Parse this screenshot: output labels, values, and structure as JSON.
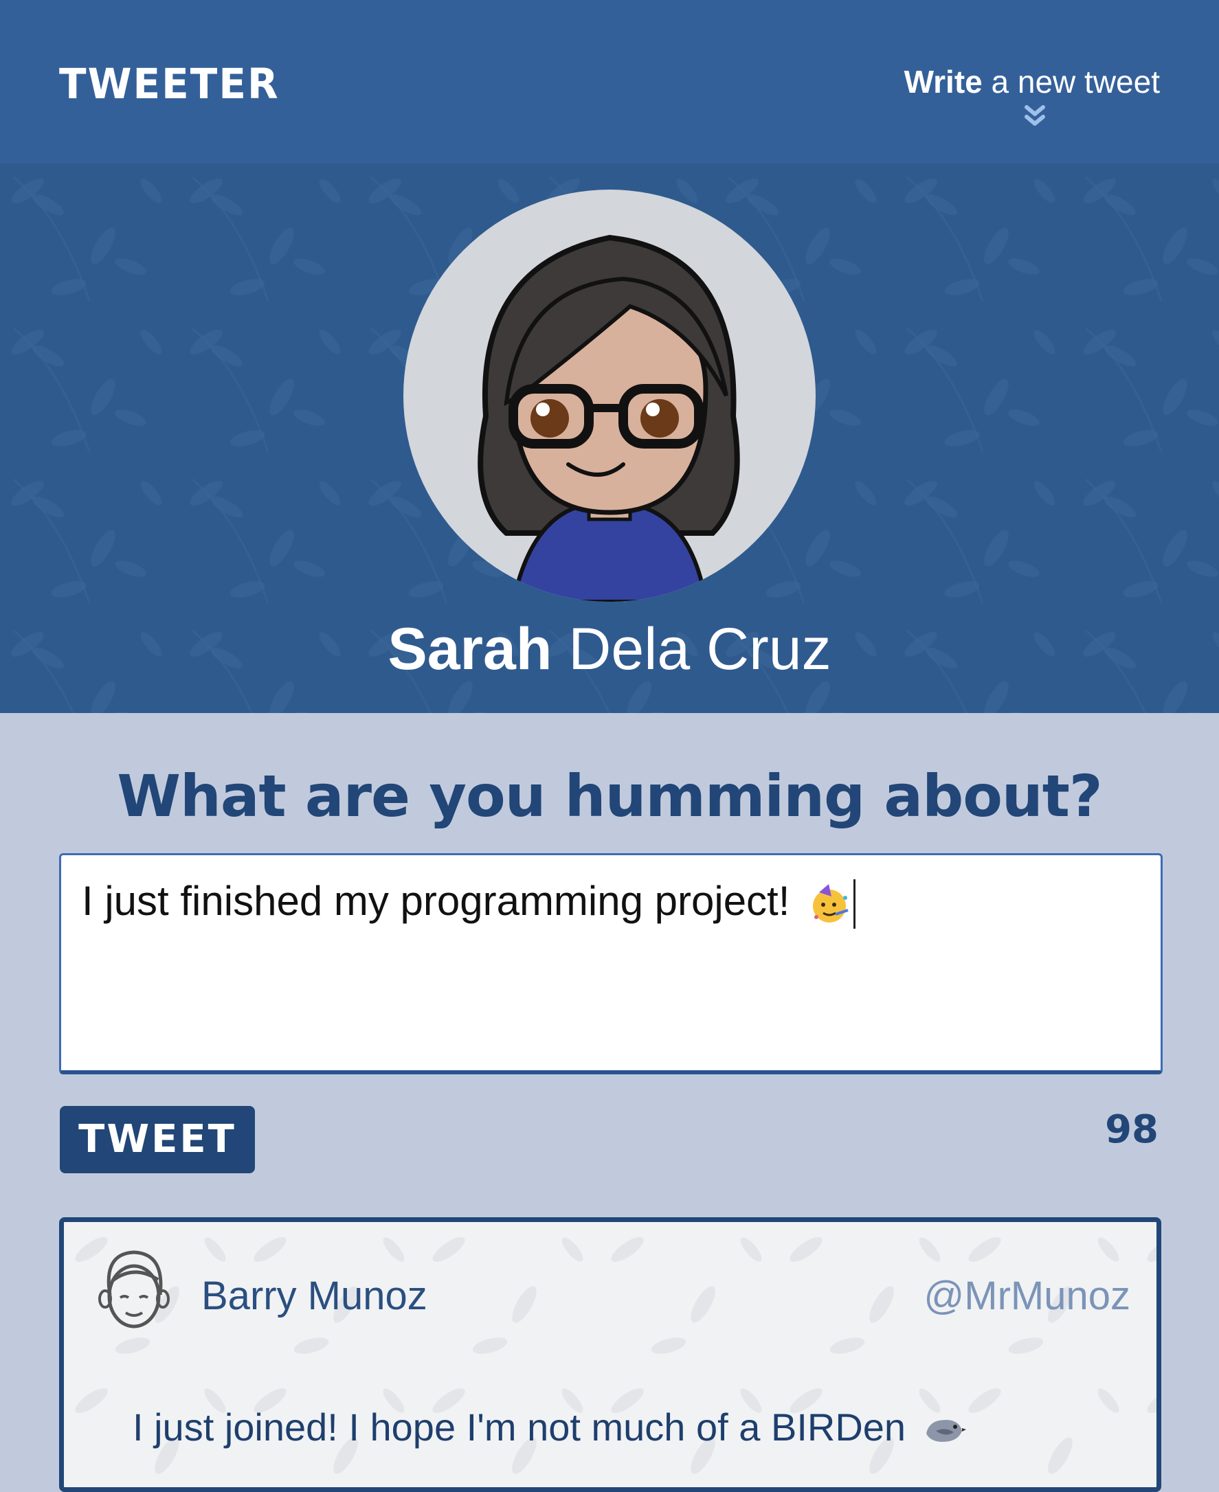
{
  "nav": {
    "brand": "TWEETER",
    "write_bold": "Write",
    "write_rest": " a new tweet",
    "chevron_icon": "double-chevron-down-icon"
  },
  "profile": {
    "first_name": "Sarah",
    "last_name": " Dela Cruz"
  },
  "compose": {
    "title": "What are you humming about?",
    "text": "I just finished my programming project! ",
    "emoji": "partying-face-icon",
    "button_label": "TWEET",
    "counter": "98"
  },
  "tweets": [
    {
      "name": "Barry Munoz",
      "handle": "@MrMunoz",
      "body": "I just joined! I hope I'm not much of a BIRDen ",
      "icon": "bird-icon"
    }
  ],
  "colors": {
    "nav_bg": "#34609a",
    "header_bg": "#2f5a8e",
    "page_bg": "#c1cadc",
    "accent_dark": "#214677"
  }
}
